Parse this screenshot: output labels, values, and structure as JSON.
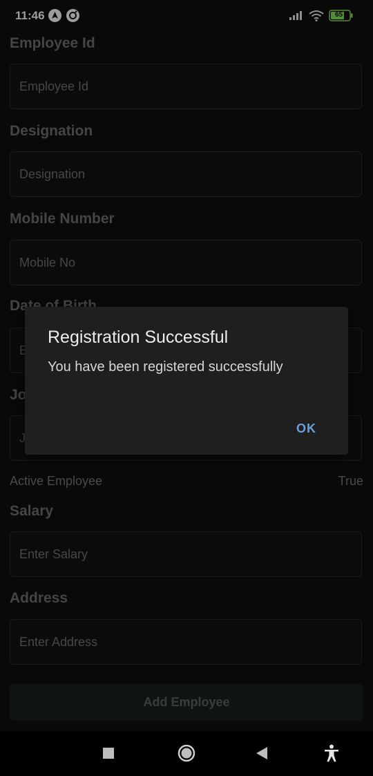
{
  "status_bar": {
    "time": "11:46",
    "battery": "65",
    "left_icons": [
      "navigation-icon",
      "sync-icon"
    ],
    "right_icons": [
      "signal-icon",
      "wifi-icon",
      "battery-icon"
    ]
  },
  "form": {
    "fields": [
      {
        "label": "Employee Id",
        "placeholder": "Employee Id"
      },
      {
        "label": "Designation",
        "placeholder": "Designation"
      },
      {
        "label": "Mobile Number",
        "placeholder": "Mobile No"
      },
      {
        "label": "Date of Birth",
        "placeholder": "E"
      },
      {
        "label": "Jo",
        "placeholder": "J"
      },
      {
        "label": "Salary",
        "placeholder": "Enter Salary"
      },
      {
        "label": "Address",
        "placeholder": "Enter Address"
      }
    ],
    "active_employee": {
      "label": "Active Employee",
      "value": "True"
    },
    "submit_label": "Add Employee"
  },
  "dialog": {
    "title": "Registration Successful",
    "message": "You have been registered successfully",
    "ok_label": "OK"
  },
  "nav_bar": {
    "buttons": [
      "recents-icon",
      "home-icon",
      "back-icon",
      "accessibility-icon"
    ]
  },
  "colors": {
    "background": "#0f0f0f",
    "dialog": "#1f1f1f",
    "accent": "#6b9fd8",
    "battery": "#7ed957"
  }
}
